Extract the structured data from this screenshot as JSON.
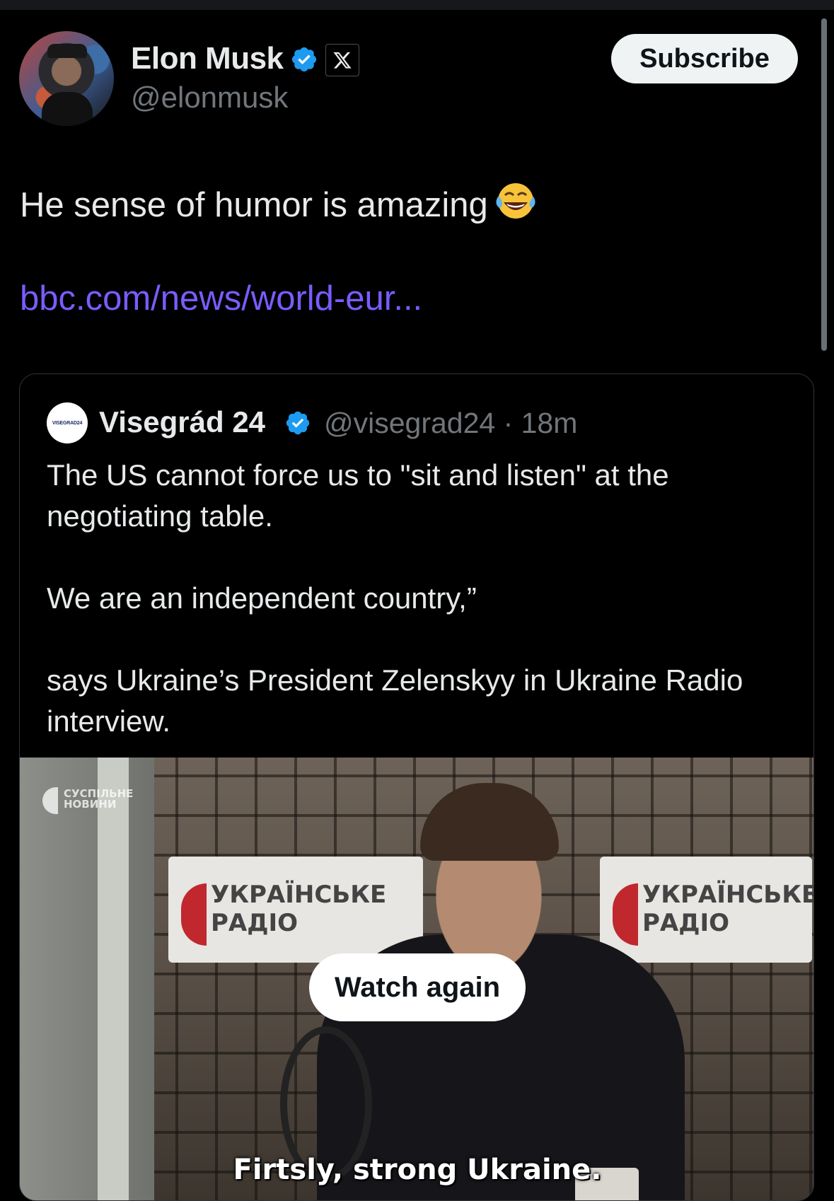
{
  "author": {
    "display_name": "Elon Musk",
    "handle": "@elonmusk",
    "verified": true,
    "affiliate_badge": "x-logo-icon"
  },
  "subscribe_label": "Subscribe",
  "tweet": {
    "text": "He sense of humor is amazing",
    "emoji": "face-with-tears-of-joy",
    "link_text": "bbc.com/news/world-eur..."
  },
  "quote": {
    "avatar_text": "VISEGRAD24",
    "name": "Visegrád 24",
    "verified": true,
    "handle_time": "@visegrad24 · 18m",
    "paragraphs": [
      "The US cannot force us to \"sit and listen\" at the negotiating table.",
      "We are an independent country,”",
      "says Ukraine’s President Zelenskyy in Ukraine Radio interview."
    ],
    "video": {
      "watermark": "СУСПІЛЬНЕ НОВИНИ",
      "sign_text": "УКРАЇНСЬКЕ РАДІО",
      "watch_again_label": "Watch again",
      "subtitle": "Firtsly, strong Ukraine."
    }
  },
  "colors": {
    "background": "#000000",
    "text": "#e7e9ea",
    "secondary_text": "#71767b",
    "link": "#7a5cff",
    "verified_blue": "#1d9bf0"
  }
}
